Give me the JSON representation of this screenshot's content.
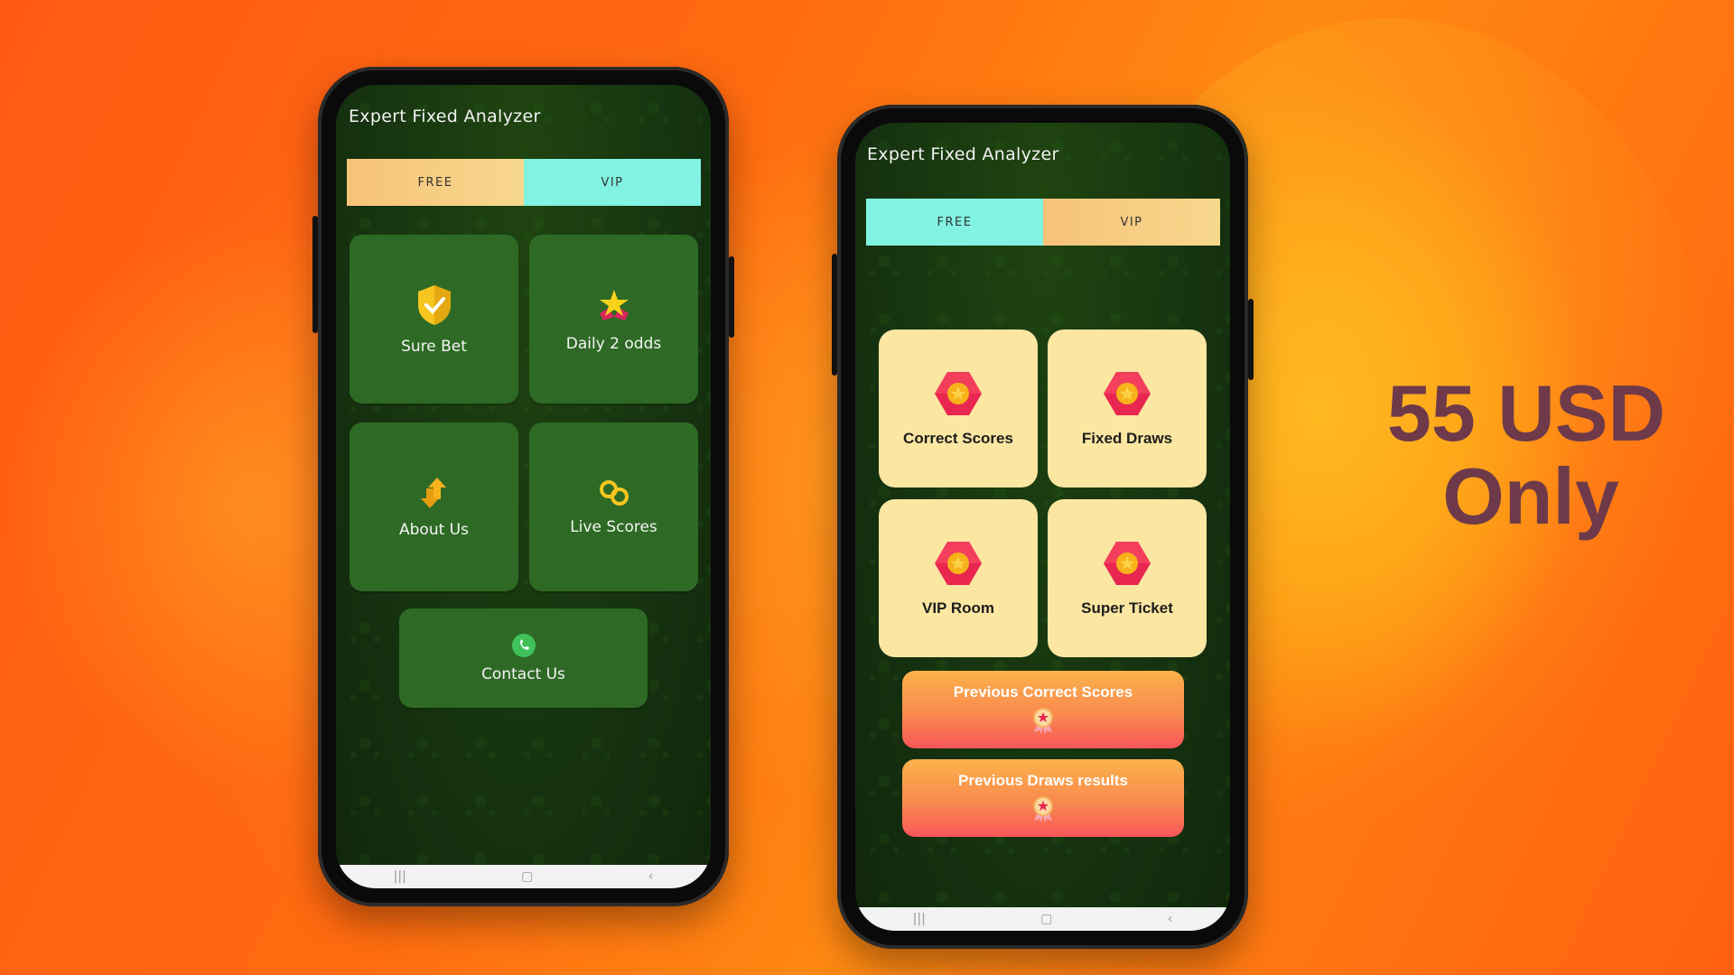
{
  "phone_left": {
    "app_title": "Expert Fixed Analyzer",
    "tabs": [
      {
        "label": "FREE",
        "active": true
      },
      {
        "label": "VIP",
        "active": false
      }
    ],
    "tiles": [
      {
        "label": "Sure Bet",
        "icon": "shield-check-icon"
      },
      {
        "label": "Daily 2 odds",
        "icon": "star-ribbon-icon"
      },
      {
        "label": "About Us",
        "icon": "up-down-arrows-icon"
      },
      {
        "label": "Live Scores",
        "icon": "rings-icon"
      }
    ],
    "contact": {
      "label": "Contact Us",
      "icon": "whatsapp-icon"
    }
  },
  "phone_right": {
    "app_title": "Expert Fixed Analyzer",
    "tabs": [
      {
        "label": "FREE",
        "active": false
      },
      {
        "label": "VIP",
        "active": true
      }
    ],
    "tiles": [
      {
        "label": "Correct Scores",
        "icon": "hexagon-badge-icon"
      },
      {
        "label": "Fixed Draws",
        "icon": "hexagon-badge-icon"
      },
      {
        "label": "VIP Room",
        "icon": "hexagon-badge-icon"
      },
      {
        "label": "Super Ticket",
        "icon": "hexagon-badge-icon"
      }
    ],
    "buttons": [
      {
        "label": "Previous Correct Scores",
        "icon": "medal-icon"
      },
      {
        "label": "Previous Draws results",
        "icon": "medal-icon"
      }
    ]
  },
  "promo": {
    "line1": "55 USD",
    "line2": "Only"
  },
  "colors": {
    "background": "#ff6a10",
    "screen_green": "#163310",
    "tile_green": "#2e6a25",
    "tile_cream": "#fbe6a2",
    "tab_aqua": "#82f2e2",
    "tab_peach": "#f7c27a",
    "price_text": "#6e3a4a"
  }
}
